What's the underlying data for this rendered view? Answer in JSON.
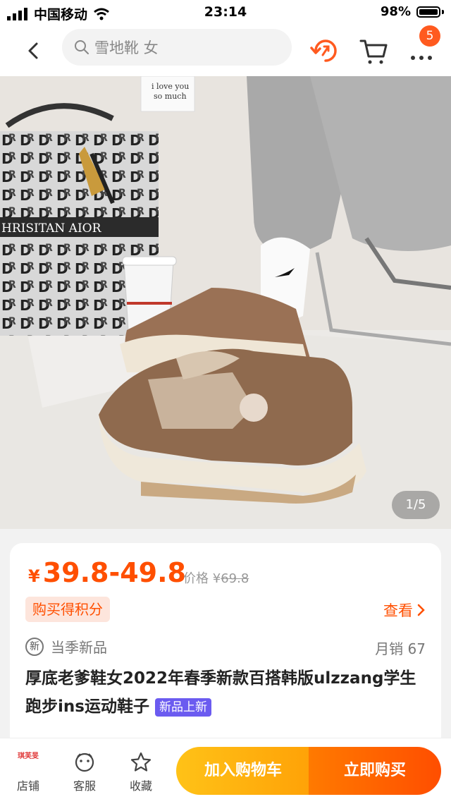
{
  "status": {
    "carrier": "中国移动",
    "time": "23:14",
    "battery": "98%"
  },
  "nav": {
    "search_placeholder": "雪地靴 女",
    "cart_badge": "5"
  },
  "hero": {
    "pager": "1/5",
    "note_text": "i love you so much",
    "bag_text": "HRISITAN AIOR"
  },
  "product": {
    "currency": "¥",
    "price": "39.8-49.8",
    "orig_label": "价格",
    "orig_currency": "¥",
    "orig_price": "69.8",
    "points": "购买得积分",
    "look": "查看",
    "new_label": "当季新品",
    "new_icon_char": "新",
    "sales": "月销 67",
    "title": "厚底老爹鞋女2022年春季新款百搭韩版ulzzang学生跑步ins运动鞋子",
    "tag": "新品上新"
  },
  "bottom": {
    "shop_logo": "琪芙旻",
    "shop": "店铺",
    "service": "客服",
    "favorite": "收藏",
    "add_cart": "加入购物车",
    "buy_now": "立即购买"
  },
  "colors": {
    "accent": "#ff4f00",
    "cart_button": "#ffb00f",
    "buy_button": "#ff6200",
    "tag": "#6b5bf0"
  }
}
